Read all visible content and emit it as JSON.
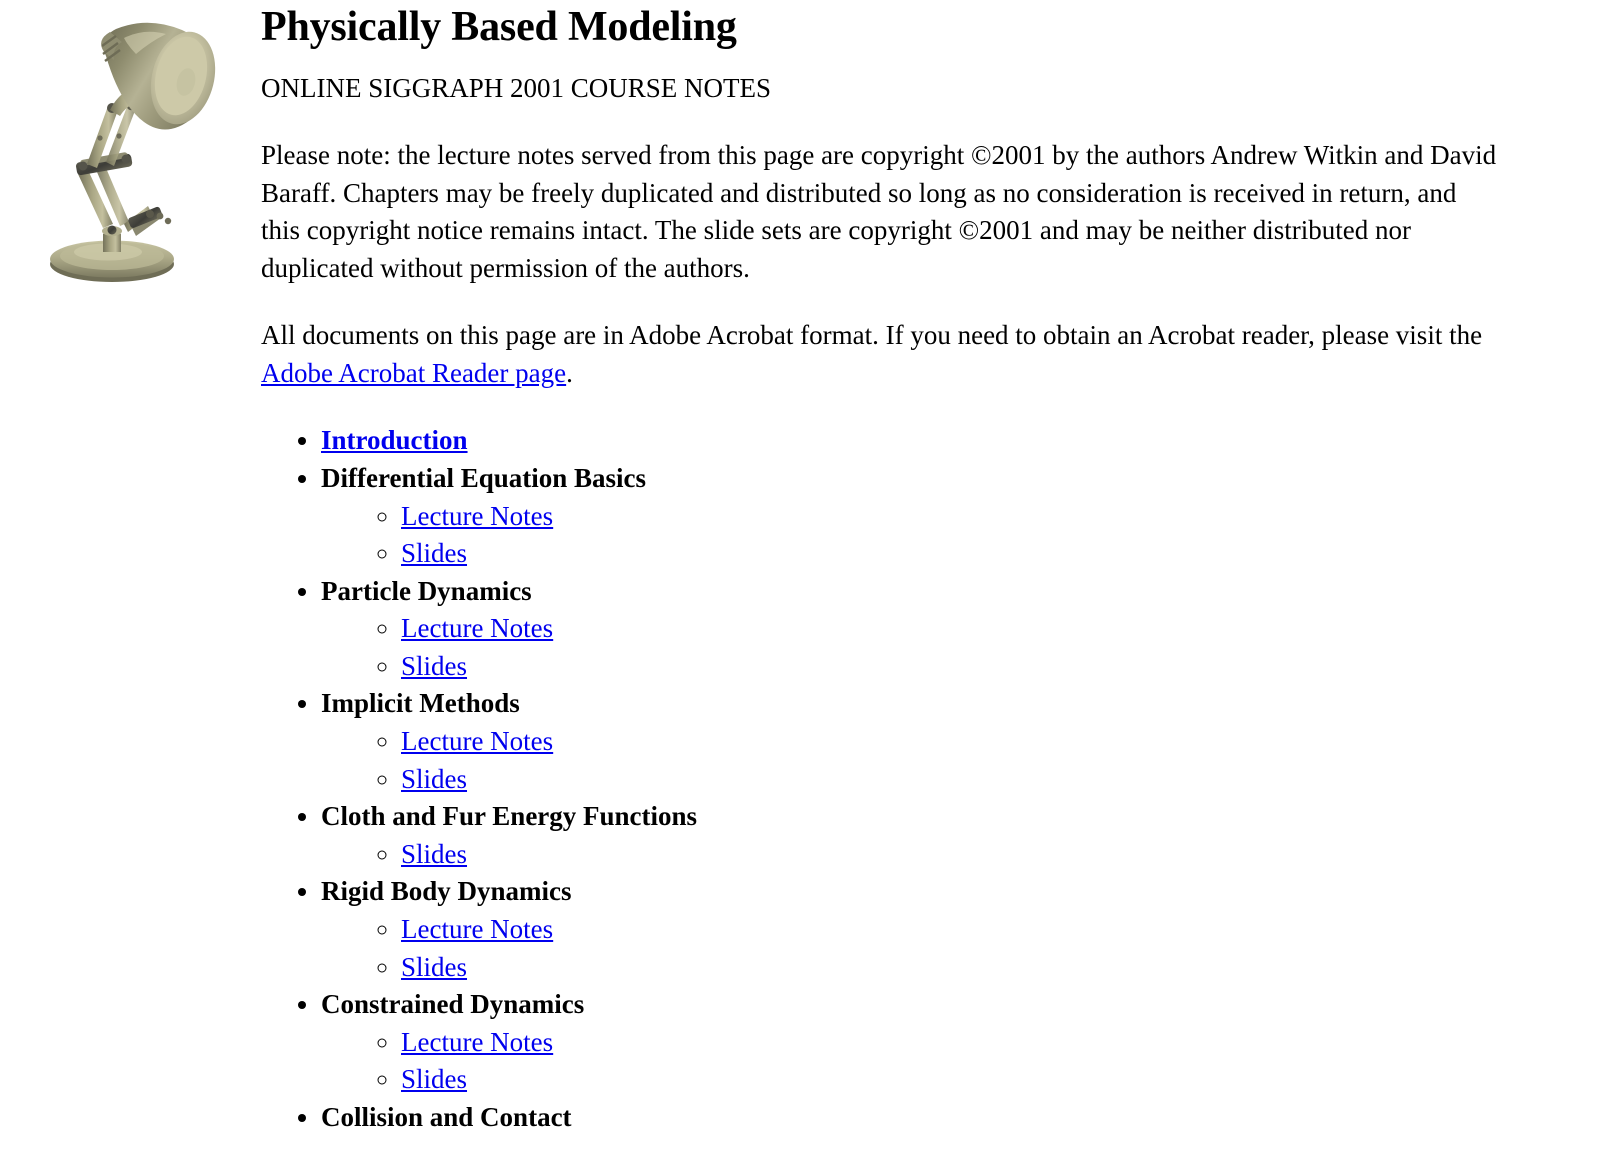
{
  "page": {
    "title": "Physically Based Modeling",
    "subtitle": "ONLINE SIGGRAPH 2001 COURSE NOTES",
    "copyright_notice": "Please note: the lecture notes served from this page are copyright ©2001 by the authors Andrew Witkin and David Baraff. Chapters may be freely duplicated and distributed so long as no consideration is received in return, and this copyright notice remains intact. The slide sets are copyright ©2001 and may be neither distributed nor duplicated without permission of the authors.",
    "acrobat_note_before": "All documents on this page are in Adobe Acrobat format. If you need to obtain an Acrobat reader, please visit the ",
    "acrobat_link_text": "Adobe Acrobat Reader page",
    "acrobat_note_after": "."
  },
  "image": {
    "alt": "luxo-lamp-image",
    "body_color": "#a9a684",
    "highlight_color": "#d7d4b5",
    "shadow_color": "#75735a",
    "joint_color": "#4a4a44"
  },
  "colors": {
    "link": "#0000ee",
    "text": "#000000",
    "background": "#ffffff"
  },
  "toc": {
    "items": [
      {
        "label": "Introduction",
        "is_link": true,
        "children": []
      },
      {
        "label": "Differential Equation Basics",
        "is_link": false,
        "children": [
          "Lecture Notes",
          "Slides"
        ]
      },
      {
        "label": "Particle Dynamics",
        "is_link": false,
        "children": [
          "Lecture Notes",
          "Slides"
        ]
      },
      {
        "label": "Implicit Methods",
        "is_link": false,
        "children": [
          "Lecture Notes",
          "Slides"
        ]
      },
      {
        "label": "Cloth and Fur Energy Functions",
        "is_link": false,
        "children": [
          "Slides"
        ]
      },
      {
        "label": "Rigid Body Dynamics",
        "is_link": false,
        "children": [
          "Lecture Notes",
          "Slides"
        ]
      },
      {
        "label": "Constrained Dynamics",
        "is_link": false,
        "children": [
          "Lecture Notes",
          "Slides"
        ]
      },
      {
        "label": "Collision and Contact",
        "is_link": false,
        "children": []
      }
    ]
  }
}
